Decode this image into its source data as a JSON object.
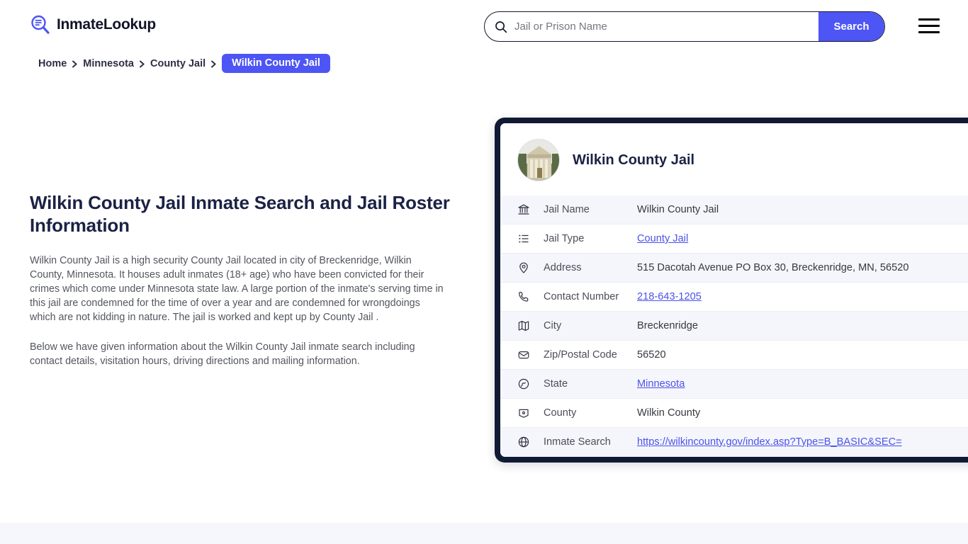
{
  "header": {
    "logo_text": "InmateLookup",
    "logo_icon": "magnifier-list-icon",
    "search": {
      "placeholder": "Jail or Prison Name",
      "value": "",
      "icon": "search-icon",
      "button_label": "Search"
    },
    "menu_icon": "hamburger-menu-icon"
  },
  "breadcrumb": {
    "items": [
      {
        "label": "Home"
      },
      {
        "label": "Minnesota"
      },
      {
        "label": "County Jail"
      }
    ],
    "current": "Wilkin County Jail",
    "separator_icon": "chevron-right-icon"
  },
  "main": {
    "title": "Wilkin County Jail Inmate Search and Jail Roster Information",
    "paragraphs": [
      "Wilkin County Jail is a high security County Jail located in city of Breckenridge, Wilkin County, Minnesota. It houses adult inmates (18+ age) who have been convicted for their crimes which come under Minnesota state law. A large portion of the inmate's serving time in this jail are condemned for the time of over a year and are condemned for wrongdoings which are not kidding in nature. The jail is worked and kept up by County Jail .",
      "Below we have given information about the Wilkin County Jail inmate search including contact details, visitation hours, driving directions and mailing information."
    ]
  },
  "card": {
    "thumbnail_alt": "courthouse-photo",
    "title": "Wilkin County Jail",
    "rows": [
      {
        "icon": "bank-icon",
        "label": "Jail Name",
        "value": "Wilkin County Jail",
        "link": false
      },
      {
        "icon": "list-icon",
        "label": "Jail Type",
        "value": "County Jail",
        "link": true
      },
      {
        "icon": "map-pin-icon",
        "label": "Address",
        "value": "515 Dacotah Avenue PO Box 30, Breckenridge, MN, 56520",
        "link": false
      },
      {
        "icon": "phone-icon",
        "label": "Contact Number",
        "value": "218-643-1205",
        "link": true
      },
      {
        "icon": "map-icon",
        "label": "City",
        "value": "Breckenridge",
        "link": false
      },
      {
        "icon": "envelope-icon",
        "label": "Zip/Postal Code",
        "value": "56520",
        "link": false
      },
      {
        "icon": "globe-state-icon",
        "label": "State",
        "value": "Minnesota",
        "link": true
      },
      {
        "icon": "county-icon",
        "label": "County",
        "value": "Wilkin County",
        "link": false
      },
      {
        "icon": "web-globe-icon",
        "label": "Inmate Search",
        "value": "https://wilkincounty.gov/index.asp?Type=B_BASIC&SEC=",
        "link": true
      }
    ]
  },
  "colors": {
    "accent": "#4d55f5",
    "dark_navy": "#111a33",
    "title_navy": "#1b2244",
    "row_alt_bg": "#f5f6fc",
    "link": "#4b52e8",
    "footer_band": "#f6f6fd"
  }
}
